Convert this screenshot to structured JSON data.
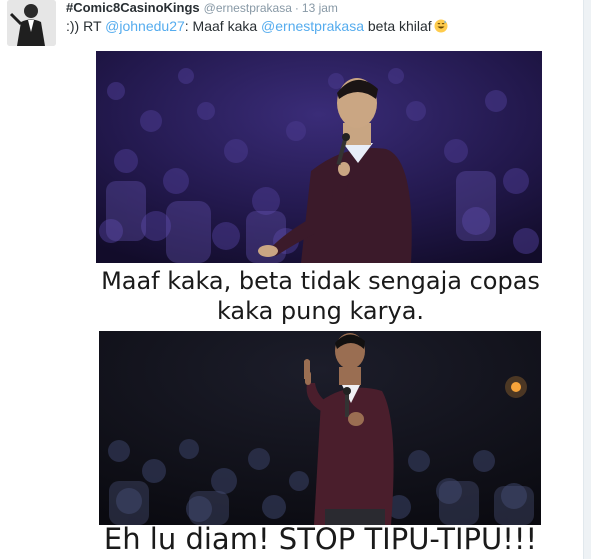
{
  "tweet": {
    "author_name": "#Comic8CasinoKings",
    "author_handle": "@ernestprakasa",
    "separator": "·",
    "timestamp": "13 jam",
    "text_prefix": ":)) RT ",
    "mention1": "@johnedu27",
    "text_middle": ": Maaf kaka ",
    "mention2": "@ernestprakasa",
    "text_suffix": " beta khilaf",
    "emoji_name": "grinning-sweat-emoji"
  },
  "meme": {
    "caption_top": "Maaf kaka, beta tidak sengaja copas kaka pung karya.",
    "caption_bottom": "Eh lu diam! STOP TIPU-TIPU!!!"
  },
  "colors": {
    "link": "#55acee",
    "meta": "#8899a6",
    "text": "#292f33",
    "stage_purple": "#2a1f5a"
  }
}
